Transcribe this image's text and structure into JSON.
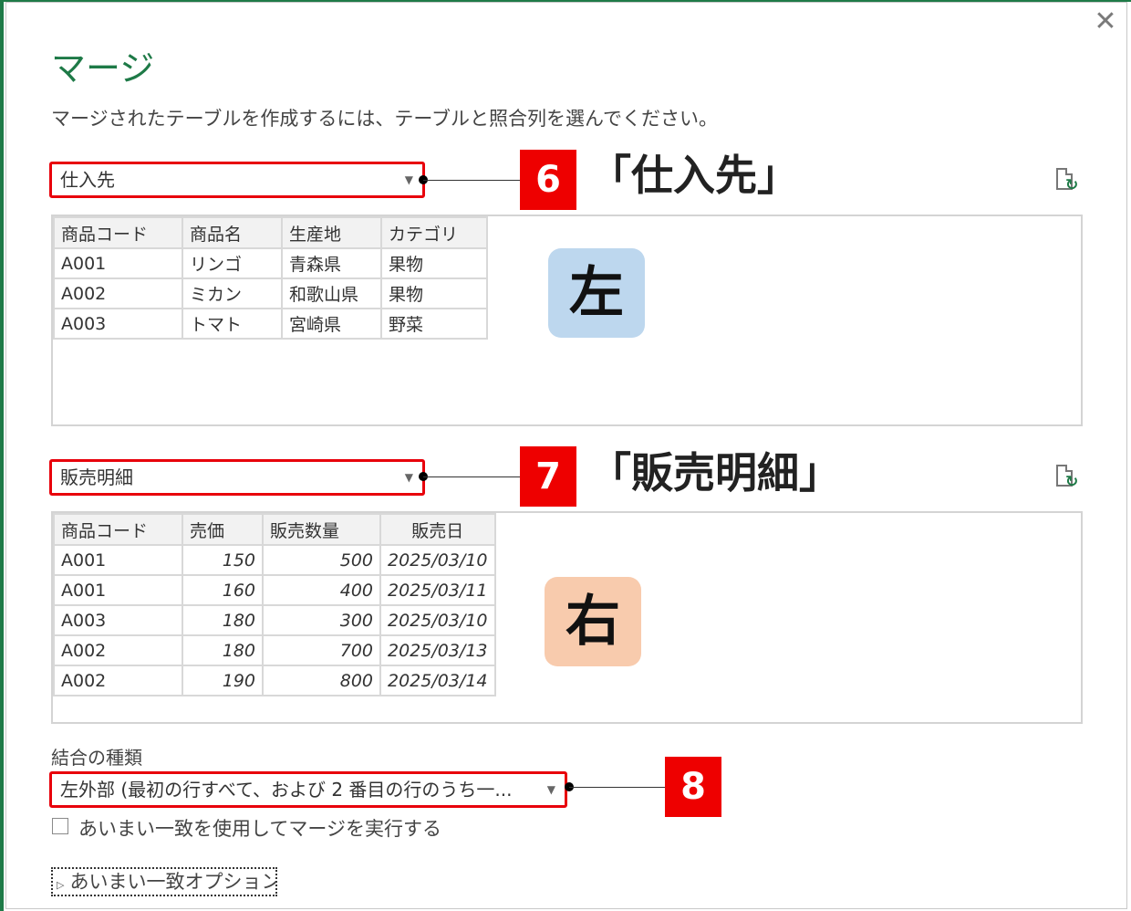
{
  "dialog": {
    "title": "マージ",
    "description": "マージされたテーブルを作成するには、テーブルと照合列を選んでください。",
    "close_glyph": "✕"
  },
  "top_table": {
    "selected": "仕入先",
    "columns": [
      "商品コード",
      "商品名",
      "生産地",
      "カテゴリ"
    ],
    "rows": [
      [
        "A001",
        "リンゴ",
        "青森県",
        "果物"
      ],
      [
        "A002",
        "ミカン",
        "和歌山県",
        "果物"
      ],
      [
        "A003",
        "トマト",
        "宮崎県",
        "野菜"
      ]
    ],
    "callout_number": "6",
    "annotation": "「仕入先」",
    "badge": "左",
    "badge_color": "#bdd7ee"
  },
  "bottom_table": {
    "selected": "販売明細",
    "columns": [
      "商品コード",
      "売価",
      "販売数量",
      "販売日"
    ],
    "rows": [
      [
        "A001",
        "150",
        "500",
        "2025/03/10"
      ],
      [
        "A001",
        "160",
        "400",
        "2025/03/11"
      ],
      [
        "A003",
        "180",
        "300",
        "2025/03/10"
      ],
      [
        "A002",
        "180",
        "700",
        "2025/03/13"
      ],
      [
        "A002",
        "190",
        "800",
        "2025/03/14"
      ]
    ],
    "callout_number": "7",
    "annotation": "「販売明細」",
    "badge": "右",
    "badge_color": "#f8cbad"
  },
  "join": {
    "label": "結合の種類",
    "selected": "左外部 (最初の行すべて、および 2 番目の行のうち一...",
    "callout_number": "8"
  },
  "fuzzy": {
    "checkbox_label": "あいまい一致を使用してマージを実行する",
    "checked": false,
    "options_label": "あいまい一致オプション"
  },
  "colors": {
    "accent": "#1e7a47",
    "highlight": "#e8000b",
    "callout": "#ee0000"
  }
}
